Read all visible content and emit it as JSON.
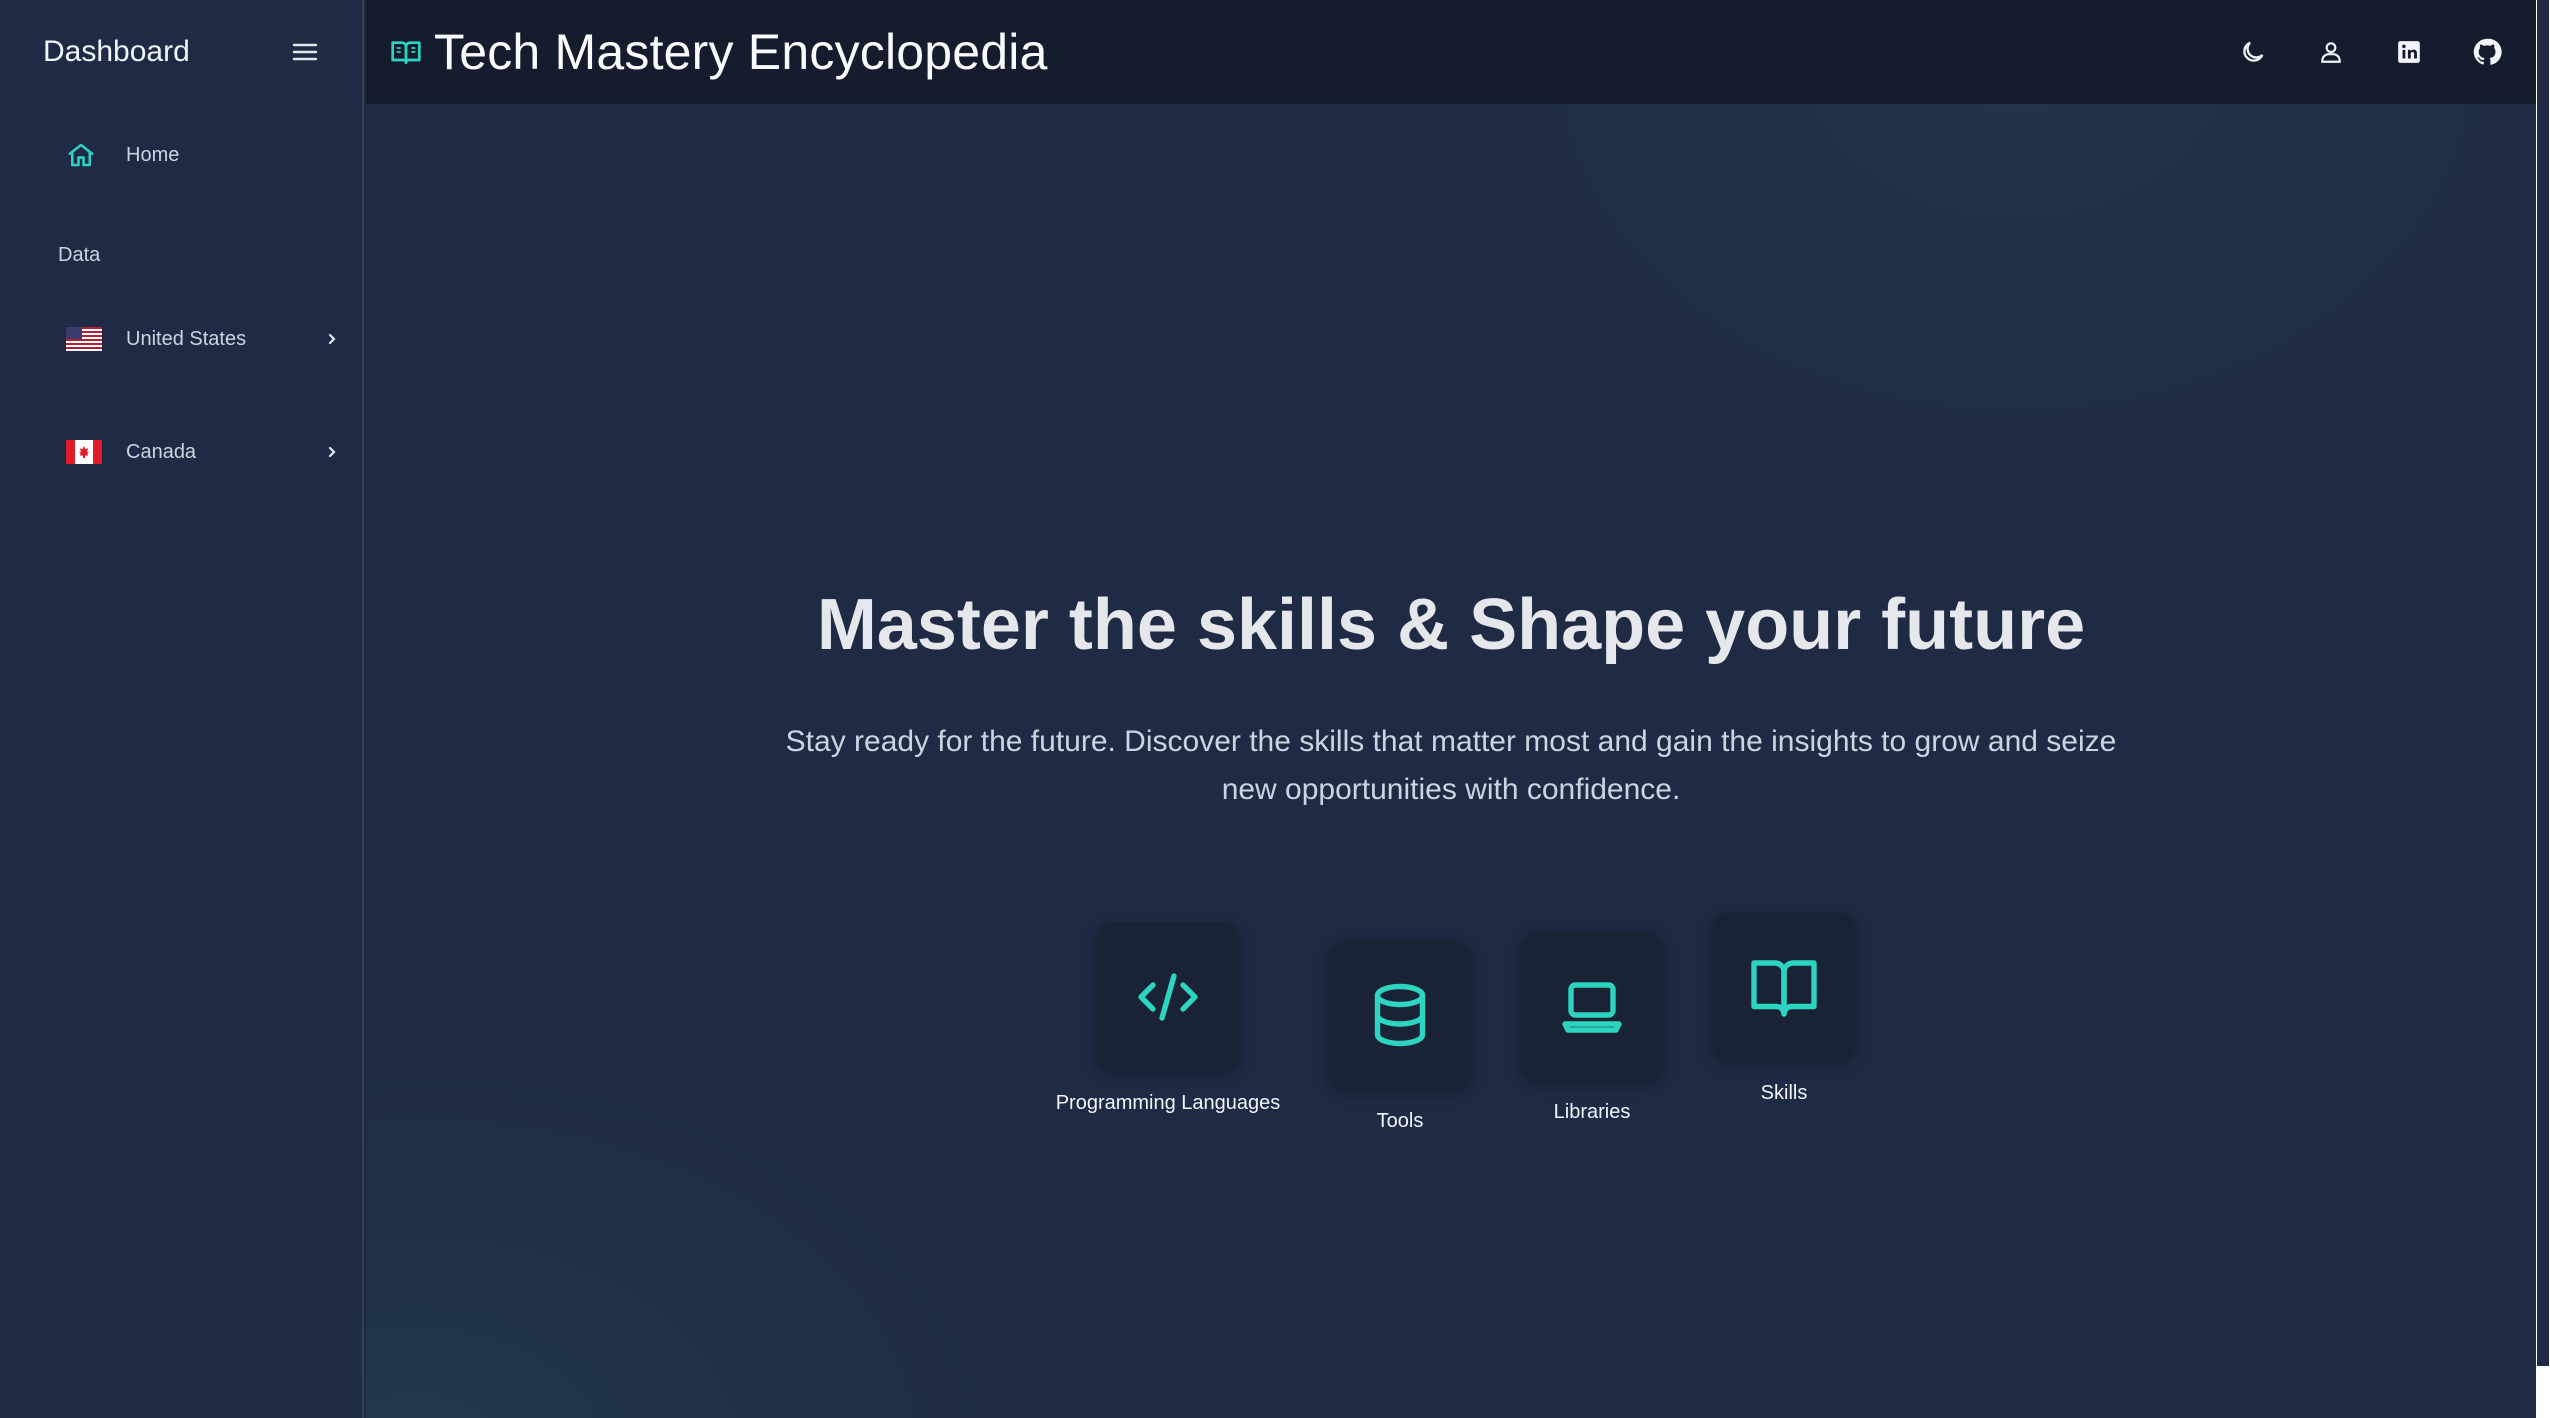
{
  "sidebar": {
    "title": "Dashboard",
    "home_label": "Home",
    "section_label": "Data",
    "countries": [
      {
        "label": "United States"
      },
      {
        "label": "Canada"
      }
    ]
  },
  "topbar": {
    "title": "Tech Mastery Encyclopedia",
    "actions": [
      "moon-icon",
      "user-icon",
      "linkedin-icon",
      "github-icon"
    ]
  },
  "hero": {
    "title": "Master the skills & Shape your future",
    "subtitle": "Stay ready for the future. Discover the skills that matter most and gain the insights to grow and seize new opportunities with confidence."
  },
  "categories": [
    {
      "label": "Programming Languages",
      "icon": "code-icon"
    },
    {
      "label": "Tools",
      "icon": "database-icon"
    },
    {
      "label": "Libraries",
      "icon": "laptop-icon"
    },
    {
      "label": "Skills",
      "icon": "book-icon"
    }
  ],
  "colors": {
    "accent": "#2dd4bf",
    "background": "#1f2a44",
    "topbar": "#151c2e"
  }
}
